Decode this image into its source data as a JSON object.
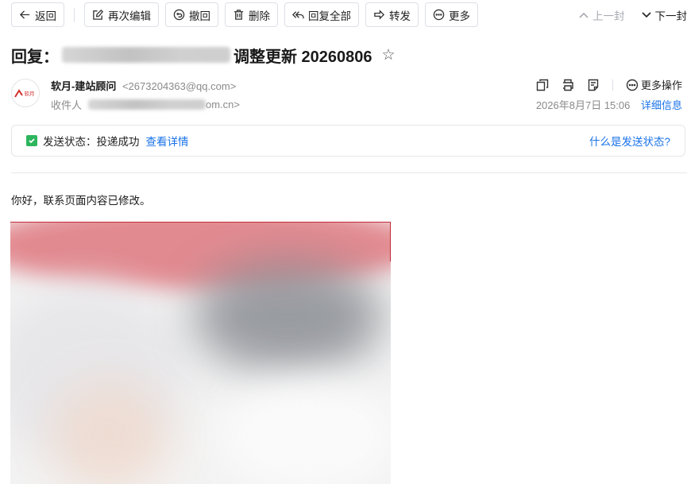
{
  "toolbar": {
    "back": "返回",
    "edit_again": "再次编辑",
    "recall": "撤回",
    "delete": "删除",
    "reply_all": "回复全部",
    "forward": "转发",
    "more": "更多"
  },
  "nav": {
    "prev": "上一封",
    "next": "下一封"
  },
  "mail": {
    "subject_prefix": "回复：",
    "subject_suffix": "调整更新 20260806",
    "sender_name": "软月-建站顾问",
    "sender_email": "<2673204363@qq.com>",
    "recipient_label": "收件人",
    "recipient_suffix": "om.cn>",
    "datetime": "2026年8月7日 15:06",
    "detail_link": "详细信息",
    "more_actions": "更多操作",
    "body": "你好，联系页面内容已修改。"
  },
  "status": {
    "label": "发送状态：",
    "value": "投递成功",
    "detail_link": "查看详情",
    "help_link": "什么是发送状态?"
  },
  "icons": {
    "back": "arrow-left-icon",
    "edit": "edit-icon",
    "recall": "recall-icon",
    "delete": "trash-icon",
    "reply_all": "reply-all-icon",
    "forward": "forward-icon",
    "more": "more-icon",
    "prev": "chevron-up-icon",
    "next": "chevron-down-icon",
    "star": "star-icon"
  },
  "colors": {
    "accent": "#1a73e8",
    "success": "#2db55d",
    "muted": "#8a8a8a"
  }
}
